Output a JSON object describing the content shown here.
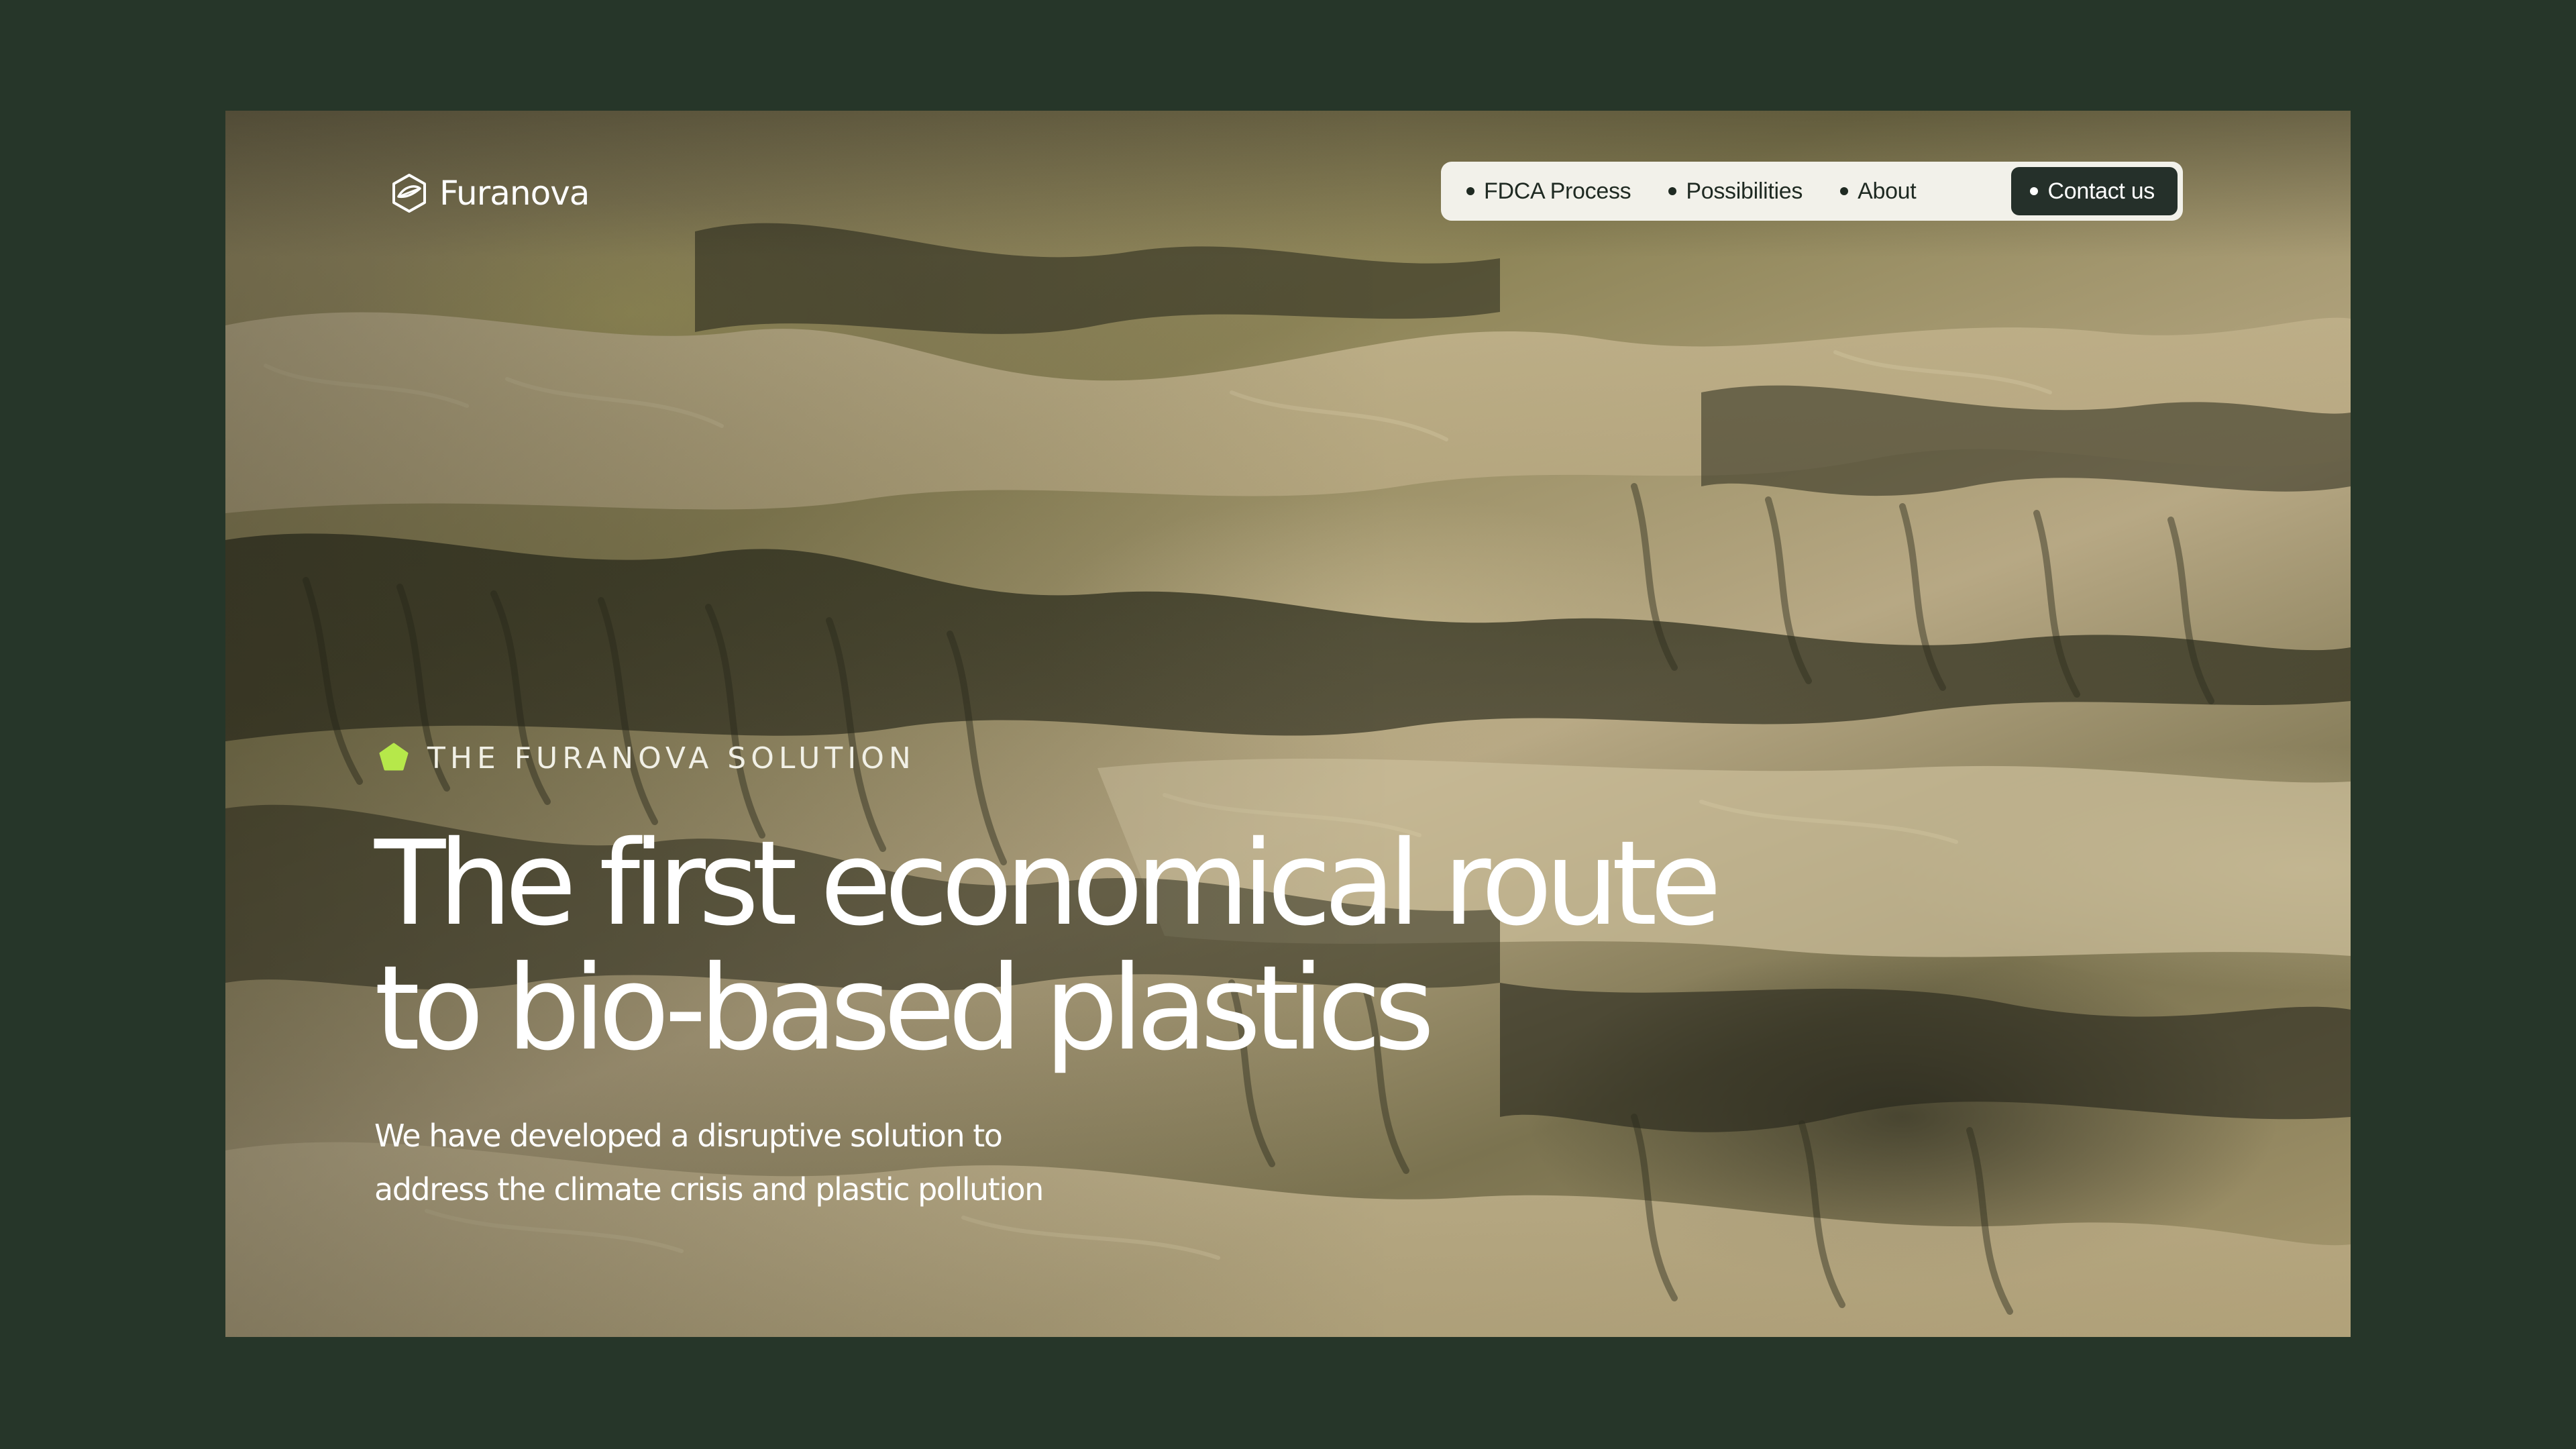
{
  "brand": {
    "name": "Furanova",
    "logo_icon": "hexagon-leaf-icon"
  },
  "nav": {
    "items": [
      {
        "label": "FDCA Process"
      },
      {
        "label": "Possibilities"
      },
      {
        "label": "About"
      }
    ],
    "contact_label": "Contact us"
  },
  "hero": {
    "eyebrow": "THE FURANOVA SOLUTION",
    "eyebrow_icon": "pentagon-icon",
    "headline_line1": "The first economical route",
    "headline_line2": "to bio-based plastics",
    "subtext_line1": "We have developed a disruptive solution to",
    "subtext_line2": "address the climate crisis and plastic pollution"
  },
  "colors": {
    "page_background": "#263629",
    "accent_green": "#b6e84a",
    "nav_background": "#f2f1ea",
    "contact_button": "#25302a",
    "text_light": "#ffffff"
  }
}
